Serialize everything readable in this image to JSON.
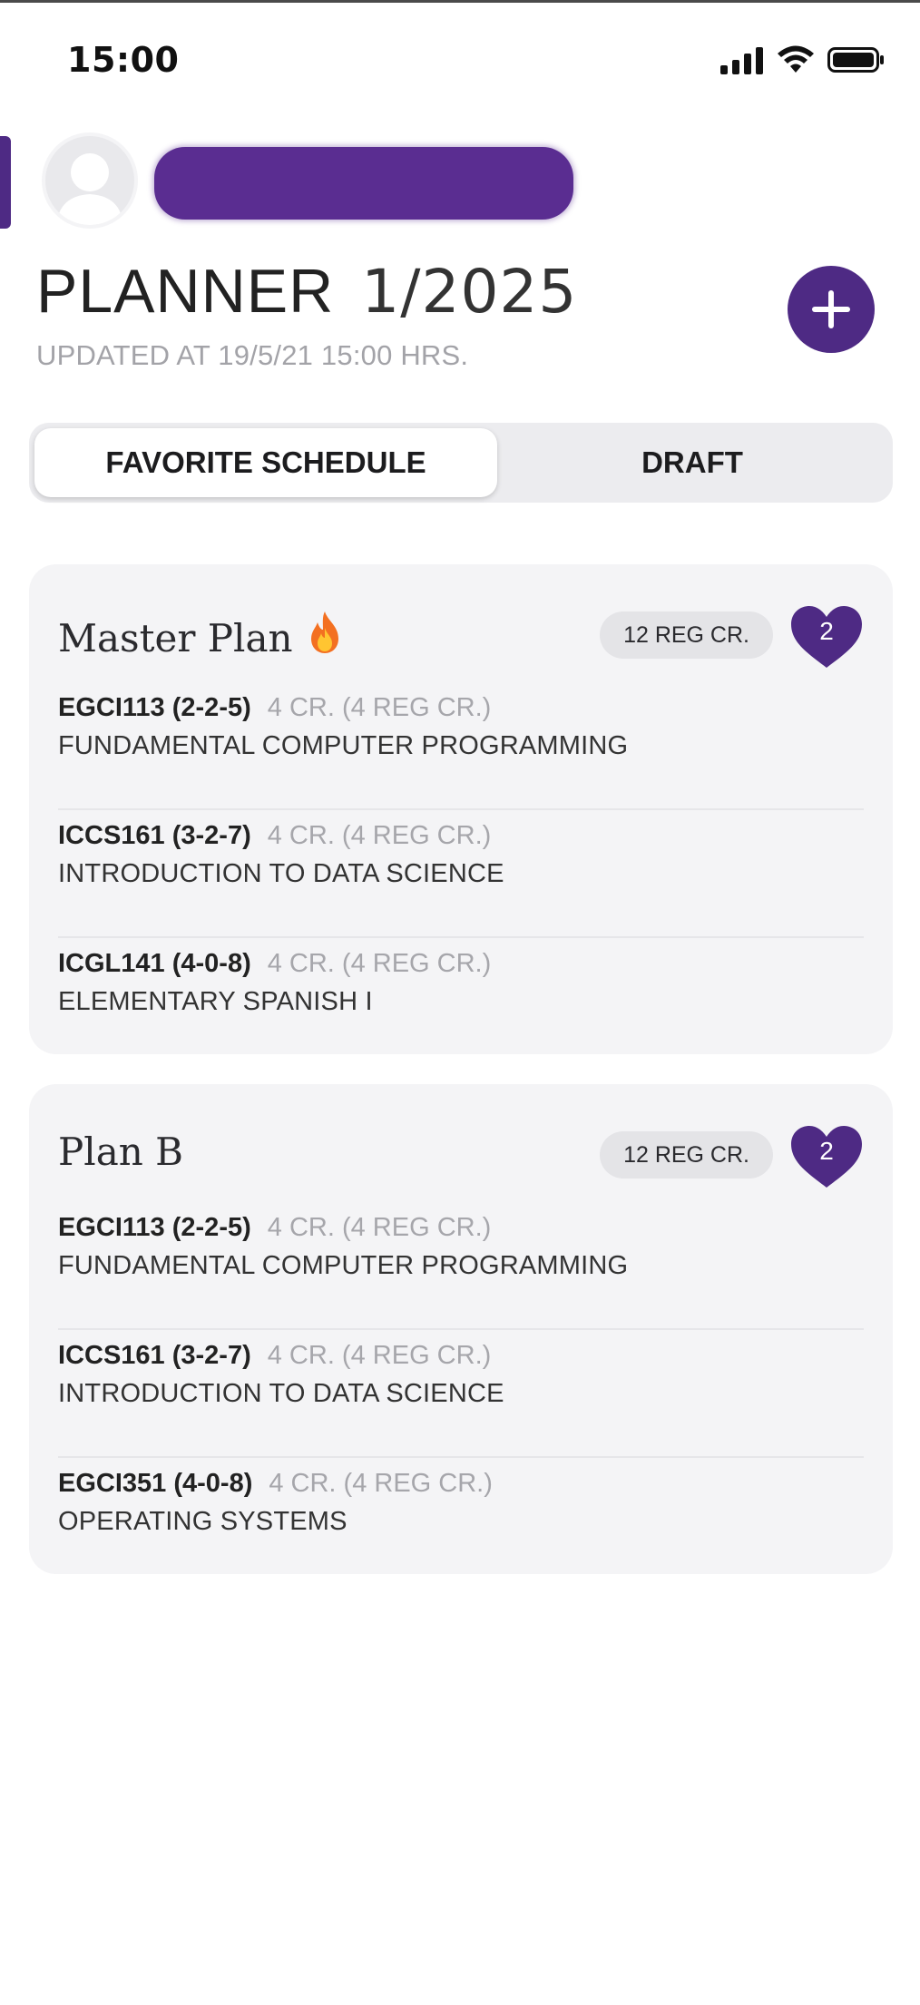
{
  "status_bar": {
    "time": "15:00"
  },
  "header": {
    "title": "PLANNER",
    "term": "1/2025",
    "updated": "UPDATED AT 19/5/21 15:00 HRS."
  },
  "tabs": [
    {
      "label": "FAVORITE SCHEDULE",
      "active": true
    },
    {
      "label": "DRAFT",
      "active": false
    }
  ],
  "plans": [
    {
      "name": "Master Plan",
      "icon": "fire-icon",
      "credits": "12 REG CR.",
      "favorites": "2",
      "courses": [
        {
          "code": "EGCI113 (2-2-5)",
          "credits": "4 CR. (4 REG CR.)",
          "name": "FUNDAMENTAL COMPUTER PROGRAMMING"
        },
        {
          "code": "ICCS161 (3-2-7)",
          "credits": "4 CR. (4 REG CR.)",
          "name": "INTRODUCTION TO DATA SCIENCE"
        },
        {
          "code": "ICGL141 (4-0-8)",
          "credits": "4 CR. (4 REG CR.)",
          "name": "ELEMENTARY SPANISH I"
        }
      ]
    },
    {
      "name": "Plan B",
      "credits": "12 REG CR.",
      "favorites": "2",
      "courses": [
        {
          "code": "EGCI113 (2-2-5)",
          "credits": "4 CR. (4 REG CR.)",
          "name": "FUNDAMENTAL COMPUTER PROGRAMMING"
        },
        {
          "code": "ICCS161 (3-2-7)",
          "credits": "4 CR. (4 REG CR.)",
          "name": "INTRODUCTION TO DATA SCIENCE"
        },
        {
          "code": "EGCI351 (4-0-8)",
          "credits": "4 CR. (4 REG CR.)",
          "name": "OPERATING SYSTEMS"
        }
      ]
    }
  ],
  "colors": {
    "accent": "#4e2a84",
    "card_bg": "#f4f4f6",
    "muted_text": "#a3a3a8"
  }
}
